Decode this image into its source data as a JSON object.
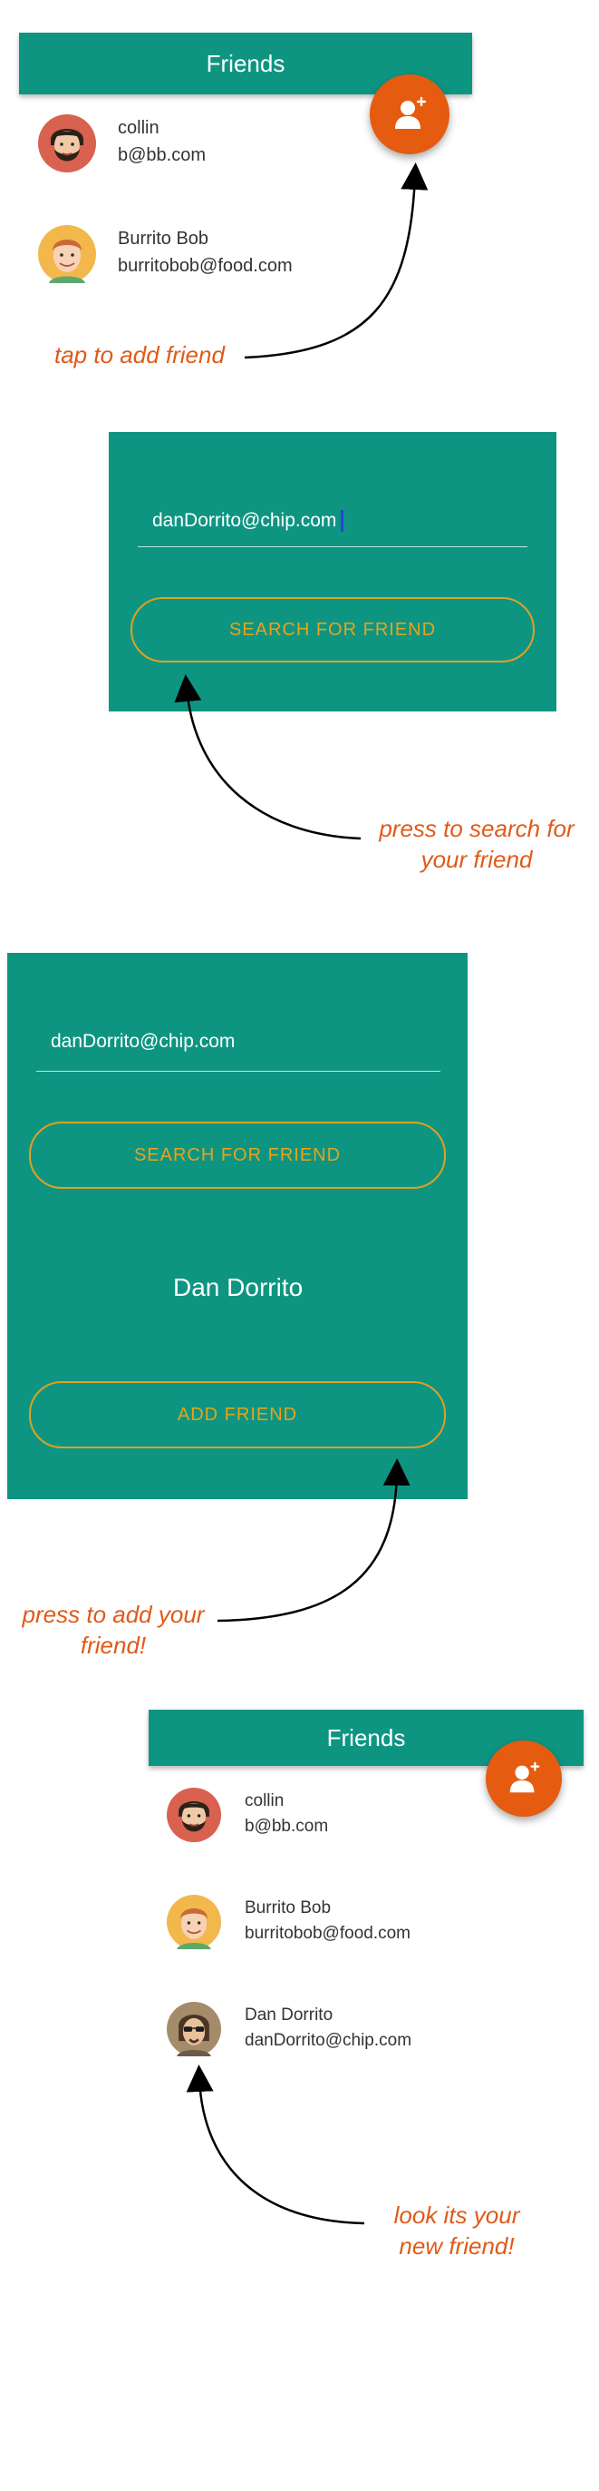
{
  "screen1": {
    "title": "Friends",
    "add_icon": "add-person-icon",
    "friends": [
      {
        "name": "collin",
        "email": "b@bb.com",
        "avatar": "bearded-man-avatar"
      },
      {
        "name": "Burrito Bob",
        "email": "burritobob@food.com",
        "avatar": "redhead-man-avatar"
      }
    ],
    "note": "tap to add friend"
  },
  "screen2": {
    "email_value": "danDorrito@chip.com",
    "search_button": "SEARCH FOR FRIEND",
    "note_line1": "press to search for",
    "note_line2": "your friend"
  },
  "screen3": {
    "email_value": "danDorrito@chip.com",
    "search_button": "SEARCH FOR FRIEND",
    "result_name": "Dan Dorrito",
    "add_button": "ADD FRIEND",
    "note_line1": "press to add your",
    "note_line2": "friend!"
  },
  "screen4": {
    "title": "Friends",
    "add_icon": "add-person-icon",
    "friends": [
      {
        "name": "collin",
        "email": "b@bb.com",
        "avatar": "bearded-man-avatar"
      },
      {
        "name": "Burrito Bob",
        "email": "burritobob@food.com",
        "avatar": "redhead-man-avatar"
      },
      {
        "name": "Dan Dorrito",
        "email": "danDorrito@chip.com",
        "avatar": "sunglasses-man-avatar"
      }
    ],
    "note_line1": "look its your",
    "note_line2": "new friend!"
  },
  "colors": {
    "teal": "#0e9582",
    "fab_orange": "#e55b0f",
    "button_outline": "#e0a020",
    "annotation": "#e05a18"
  }
}
